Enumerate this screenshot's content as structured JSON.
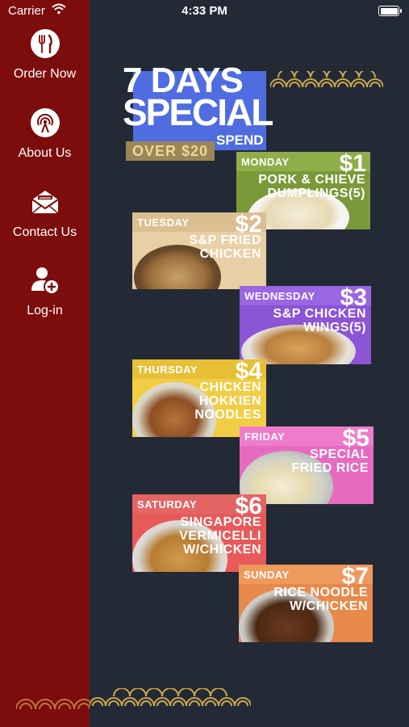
{
  "status_bar": {
    "carrier": "Carrier",
    "time": "4:33 PM",
    "icons": [
      "wifi-icon",
      "battery-icon"
    ]
  },
  "sidebar": {
    "items": [
      {
        "label": "Order Now",
        "icon": "utensils-icon"
      },
      {
        "label": "About Us",
        "icon": "broadcast-icon"
      },
      {
        "label": "Contact Us",
        "icon": "envelope-icon"
      },
      {
        "label": "Log-in",
        "icon": "add-user-icon"
      }
    ]
  },
  "poster": {
    "title_line1": "7 DAYS",
    "title_line2": "SPECIAL",
    "spend": "SPEND",
    "over": "OVER $20",
    "days": [
      {
        "day": "MONDAY",
        "price": "$1",
        "dish": "PORK & CHIEVE\nDUMPLINGS(5)",
        "color": "#7a9a3a"
      },
      {
        "day": "TUESDAY",
        "price": "$2",
        "dish": "S&P FRIED\nCHICKEN",
        "color": "#e9cfa6"
      },
      {
        "day": "WEDNESDAY",
        "price": "$3",
        "dish": "S&P CHICKEN\nWINGS(5)",
        "color": "#8b55d6"
      },
      {
        "day": "THURSDAY",
        "price": "$4",
        "dish": "CHICKEN\nHOKKIEN\nNOODLES",
        "color": "#f1cd45"
      },
      {
        "day": "FRIDAY",
        "price": "$5",
        "dish": "SPECIAL\nFRIED RICE",
        "color": "#e66bc0"
      },
      {
        "day": "SATURDAY",
        "price": "$6",
        "dish": "SINGAPORE\nVERMICELLI\nW/CHICKEN",
        "color": "#e85a5a"
      },
      {
        "day": "SUNDAY",
        "price": "$7",
        "dish": "RICE NOODLE\nW/CHICKEN",
        "color": "#e8894c"
      }
    ]
  },
  "colors": {
    "sidebar": "#7d0c0c",
    "background": "#232a36",
    "title_blue": "#4f6de0",
    "gold": "#c9a84c"
  }
}
